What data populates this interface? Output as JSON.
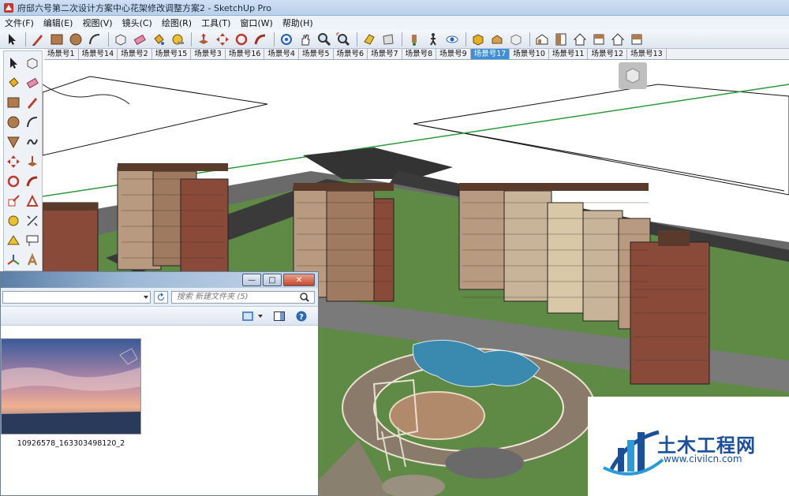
{
  "window": {
    "title": "府邸六号第二次设计方案中心花架修改调整方案2 - SketchUp Pro"
  },
  "menu": [
    {
      "label": "文件(F)"
    },
    {
      "label": "编辑(E)"
    },
    {
      "label": "视图(V)"
    },
    {
      "label": "镜头(C)"
    },
    {
      "label": "绘图(R)"
    },
    {
      "label": "工具(T)"
    },
    {
      "label": "窗口(W)"
    },
    {
      "label": "帮助(H)"
    }
  ],
  "toolbar": {
    "icons": [
      "select-icon",
      "pencil-icon",
      "rectangle-icon",
      "circle-icon",
      "arc-icon",
      "make-component-icon",
      "eraser-icon",
      "paint-bucket-icon",
      "tape-measure-icon",
      "push-pull-icon",
      "move-icon",
      "rotate-icon",
      "follow-me-icon",
      "orbit-icon",
      "pan-icon",
      "zoom-icon",
      "zoom-extents-icon",
      "previous-view-icon",
      "next-view-icon",
      "position-camera-icon",
      "walk-icon",
      "look-around-icon",
      "get-models-icon",
      "share-model-icon",
      "share-component-icon",
      "iso-view-icon",
      "top-view-icon",
      "front-view-icon",
      "right-view-icon",
      "back-view-icon",
      "left-view-icon"
    ]
  },
  "scenes": {
    "active_index": 14,
    "tabs": [
      "场景号1",
      "场景号14",
      "场景号2",
      "场景号15",
      "场景号3",
      "场景号16",
      "场景号4",
      "场景号5",
      "场景号6",
      "场景号7",
      "场景号8",
      "场景号9",
      "场景号17",
      "场景号10",
      "场景号11",
      "场景号12",
      "场景号13"
    ]
  },
  "left_tools": [
    "select",
    "make-component",
    "paint-bucket",
    "eraser",
    "rectangle",
    "line",
    "circle",
    "arc",
    "polygon",
    "freehand",
    "move",
    "push-pull",
    "rotate",
    "follow-me",
    "scale",
    "offset",
    "tape-measure",
    "dimension",
    "protractor",
    "text",
    "axes",
    "3d-text"
  ],
  "explorer": {
    "search_placeholder": "搜索 新建文件夹 (5)",
    "file_name": "10926578_163303498120_2",
    "buttons": {
      "minimize": "—",
      "maximize": "□",
      "close": "✕"
    }
  },
  "watermark": {
    "name": "土木工程网",
    "url": "www.civilcn.com"
  },
  "colors": {
    "active_tab": "#3d8fd8",
    "lawn": "#5f8a45",
    "road": "#3a3a3a",
    "building_brick": "#8a4a3a",
    "building_cream": "#d8c8a8",
    "brand_blue": "#1a4f9a"
  }
}
